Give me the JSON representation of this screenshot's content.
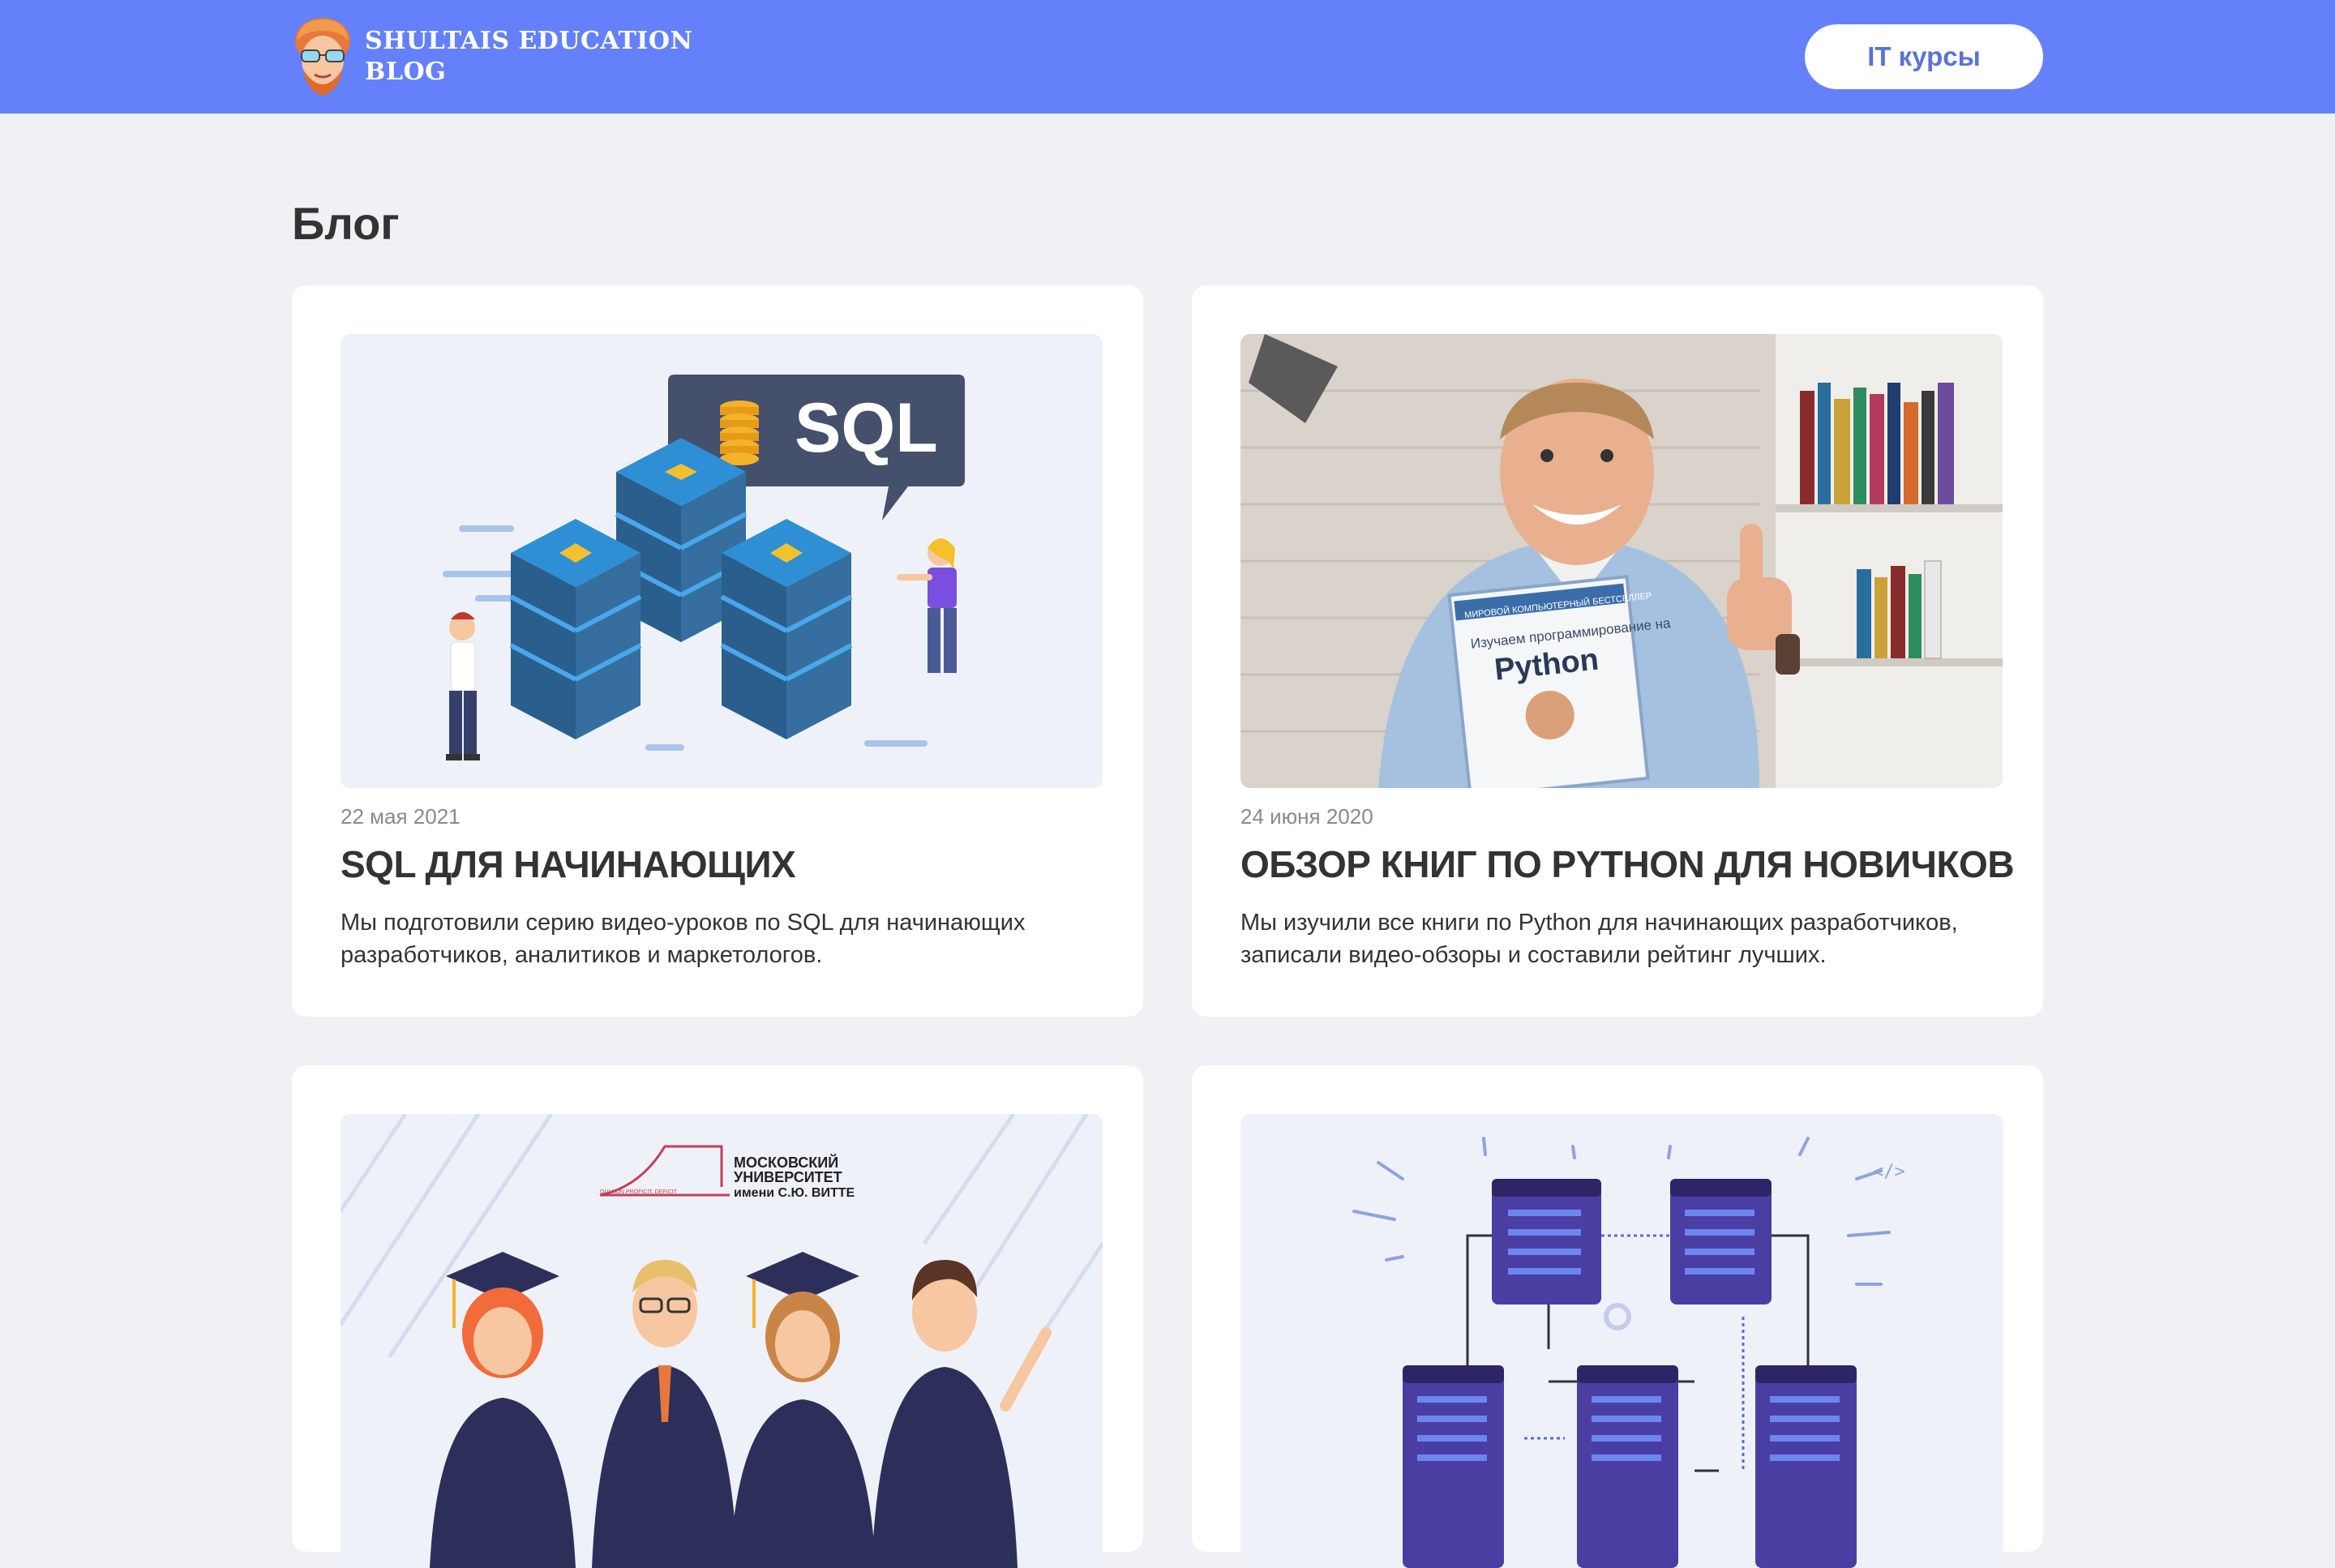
{
  "header": {
    "logo_line1": "SHULTAIS EDUCATION",
    "logo_line2": "BLOG",
    "courses_button": "IT курсы"
  },
  "page": {
    "title": "Блог"
  },
  "posts": [
    {
      "date": "22 мая 2021",
      "title": "SQL ДЛЯ НАЧИНАЮЩИХ",
      "description": "Мы подготовили серию видео-уроков по SQL для начинающих разработчиков, аналитиков и маркетологов.",
      "image_label": "SQL"
    },
    {
      "date": "24 июня 2020",
      "title": "ОБЗОР КНИГ ПО PYTHON ДЛЯ НОВИЧКОВ",
      "description": "Мы изучили все книги по Python для начинающих разработчиков, записали видео-обзоры и составили рейтинг лучших.",
      "image_book_top": "МИРОВОЙ КОМПЬЮТЕРНЫЙ БЕСТСЕЛЛЕР",
      "image_book_title": "Изучаем программирование на",
      "image_book_label": "Python"
    },
    {
      "image_university_line1": "МОСКОВСКИЙ",
      "image_university_line2": "УНИВЕРСИТЕТ",
      "image_university_line3": "имени С.Ю. ВИТТЕ",
      "image_university_motto": "QUI NON PROFICIT, DEFICIT"
    },
    {}
  ],
  "colors": {
    "header_bg": "#6481fb",
    "page_bg": "#eff1f5",
    "button_text": "#5a73d8",
    "db_blue": "#3d8dd6",
    "server_purple": "#4b3ea3"
  }
}
